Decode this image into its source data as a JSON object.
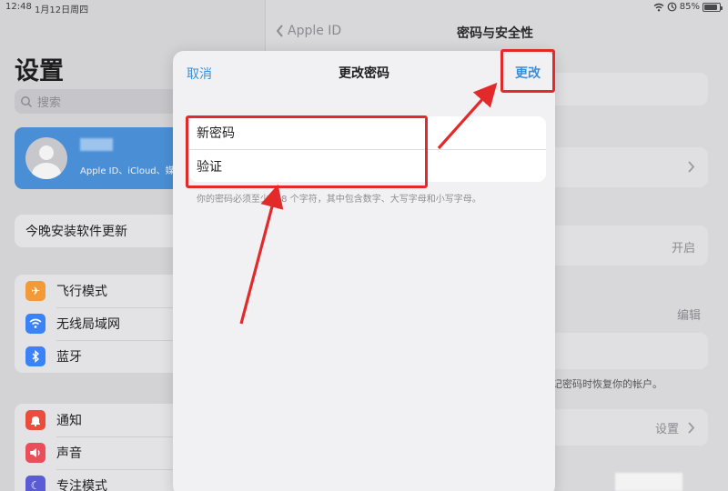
{
  "status": {
    "time": "12:48",
    "date": "1月12日周四",
    "battery": "85%",
    "battery_level": 0.85
  },
  "sidebar": {
    "title": "设置",
    "search_placeholder": "搜索",
    "account_subtitle": "Apple ID、iCloud、媒",
    "update_label": "今晚安装软件更新",
    "group1": [
      {
        "label": "飞行模式",
        "icon": "airplane-icon",
        "color": "#f29a38"
      },
      {
        "label": "无线局域网",
        "icon": "wifi-icon",
        "color": "#3a82f7"
      },
      {
        "label": "蓝牙",
        "icon": "bluetooth-icon",
        "color": "#3a82f7"
      }
    ],
    "group2": [
      {
        "label": "通知",
        "icon": "bell-icon",
        "color": "#eb4d3d"
      },
      {
        "label": "声音",
        "icon": "speaker-icon",
        "color": "#eb4d5a"
      },
      {
        "label": "专注模式",
        "icon": "moon-icon",
        "color": "#5b5bd6"
      }
    ]
  },
  "detail": {
    "back_label": "Apple ID",
    "title": "密码与安全性",
    "on_label": "开启",
    "edit_label": "编辑",
    "recovery_text": "忘记密码时恢复你的帐户。",
    "settings_label": "设置"
  },
  "modal": {
    "cancel": "取消",
    "title": "更改密码",
    "change": "更改",
    "new_password": "新密码",
    "verify": "验证",
    "hint": "你的密码必须至少为 8 个字符，其中包含数字、大写字母和小写字母。"
  },
  "colors": {
    "accent": "#3e8ed4",
    "annotation": "#e32a2a"
  }
}
